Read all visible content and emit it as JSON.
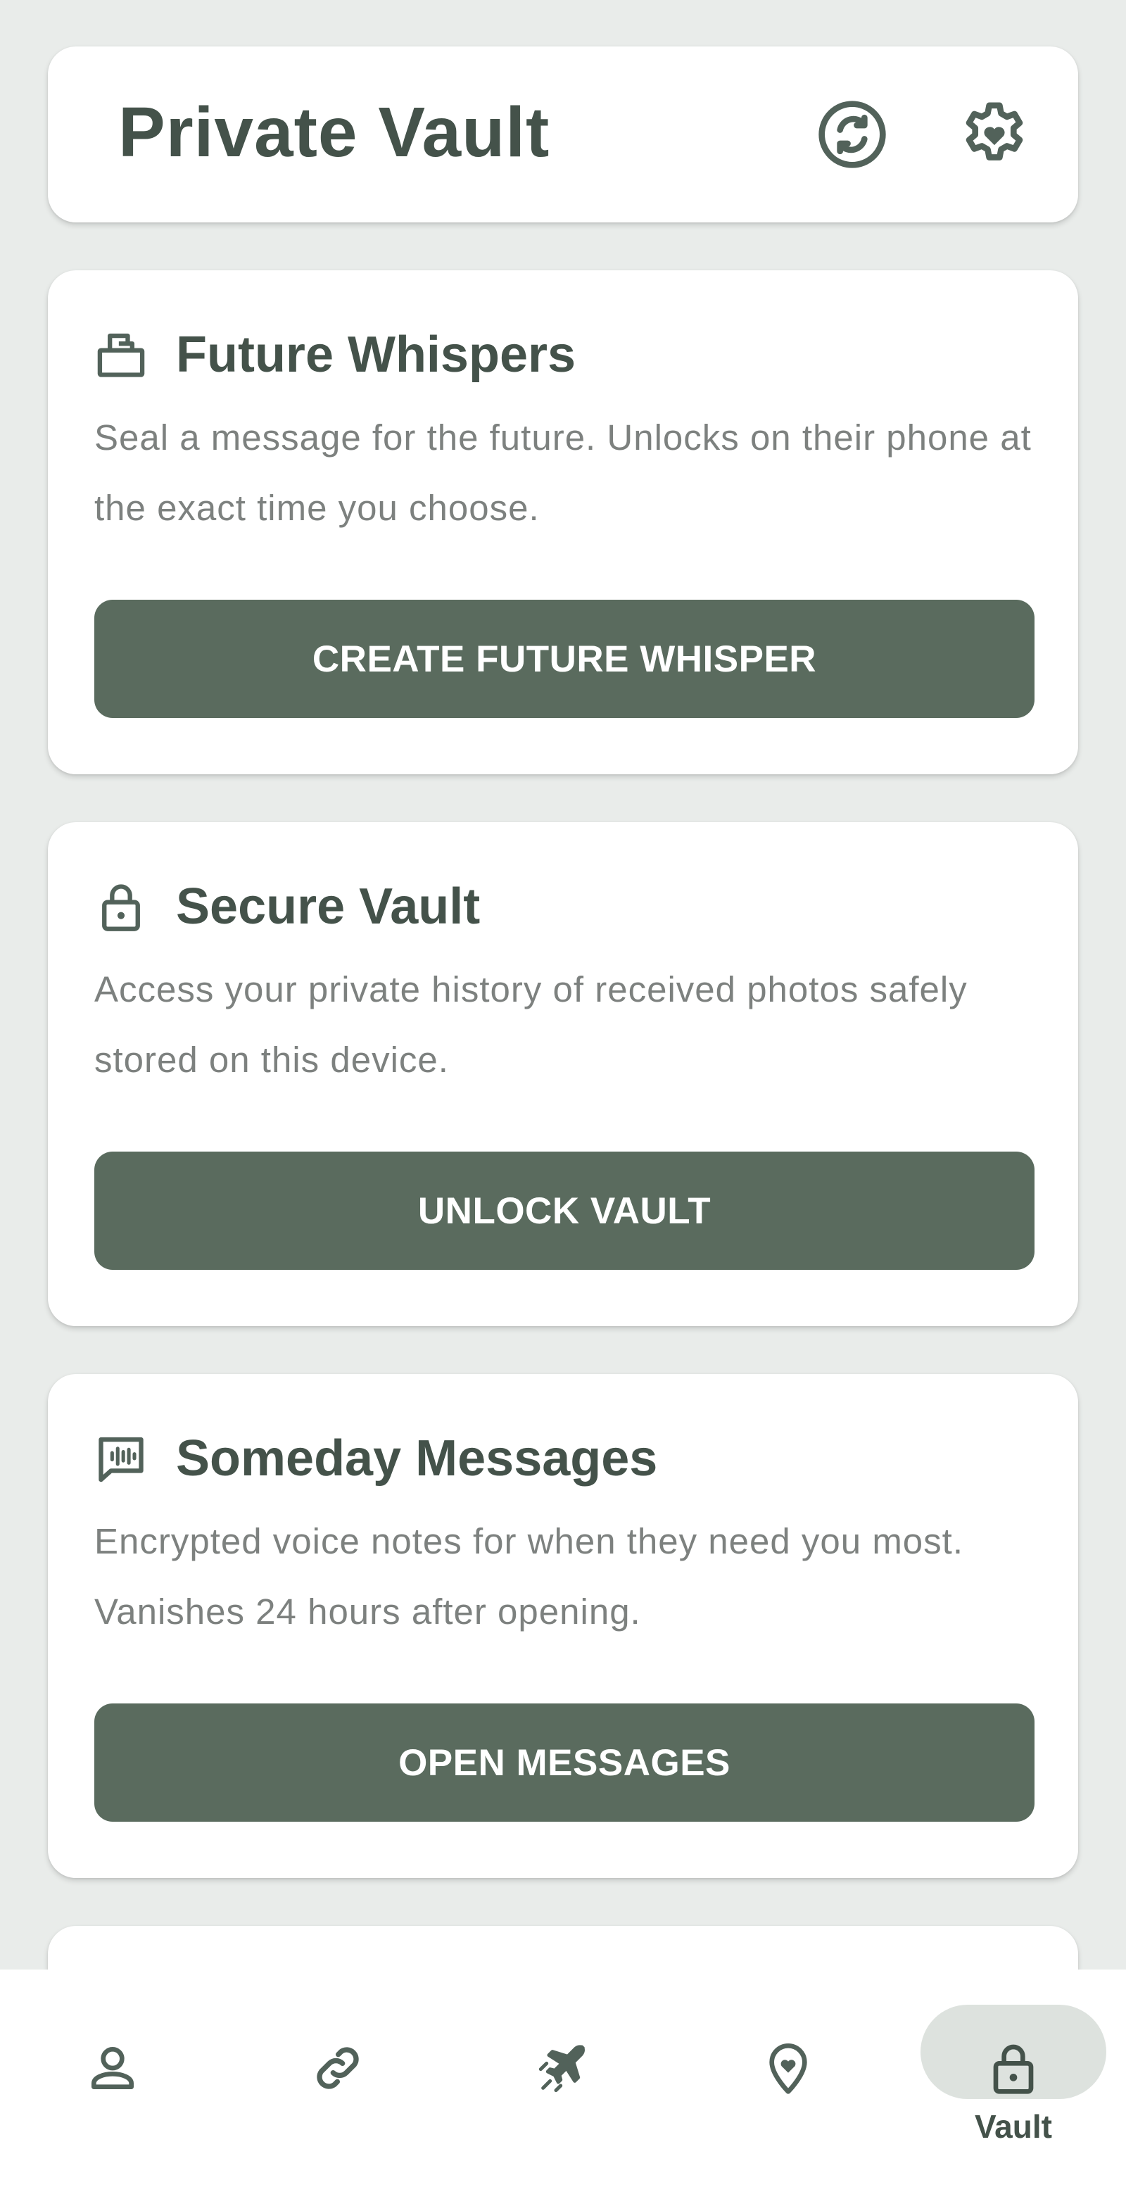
{
  "header": {
    "title": "Private Vault",
    "icons": [
      "sync-icon",
      "settings-heart-icon"
    ]
  },
  "cards": [
    {
      "icon": "send-box-icon",
      "title": "Future Whispers",
      "description": "Seal a message for the future. Unlocks on their phone at the exact time you choose.",
      "button": "CREATE FUTURE WHISPER"
    },
    {
      "icon": "lock-icon",
      "title": "Secure Vault",
      "description": "Access your private history of received photos safely stored on this device.",
      "button": "UNLOCK VAULT"
    },
    {
      "icon": "voice-message-icon",
      "title": "Someday Messages",
      "description": "Encrypted voice notes for when they need you most. Vanishes 24 hours after opening.",
      "button": "OPEN MESSAGES"
    }
  ],
  "bottom_nav": {
    "items": [
      {
        "icon": "person-icon",
        "label": ""
      },
      {
        "icon": "link-icon",
        "label": ""
      },
      {
        "icon": "airplane-icon",
        "label": ""
      },
      {
        "icon": "location-heart-icon",
        "label": ""
      },
      {
        "icon": "lock-icon",
        "label": "Vault",
        "active": true
      }
    ]
  },
  "colors": {
    "background": "#e9ecea",
    "card": "#ffffff",
    "primary": "#5a6b5e",
    "title_text": "#44524a",
    "body_text": "#7d817f",
    "active_pill": "#dde2de"
  }
}
